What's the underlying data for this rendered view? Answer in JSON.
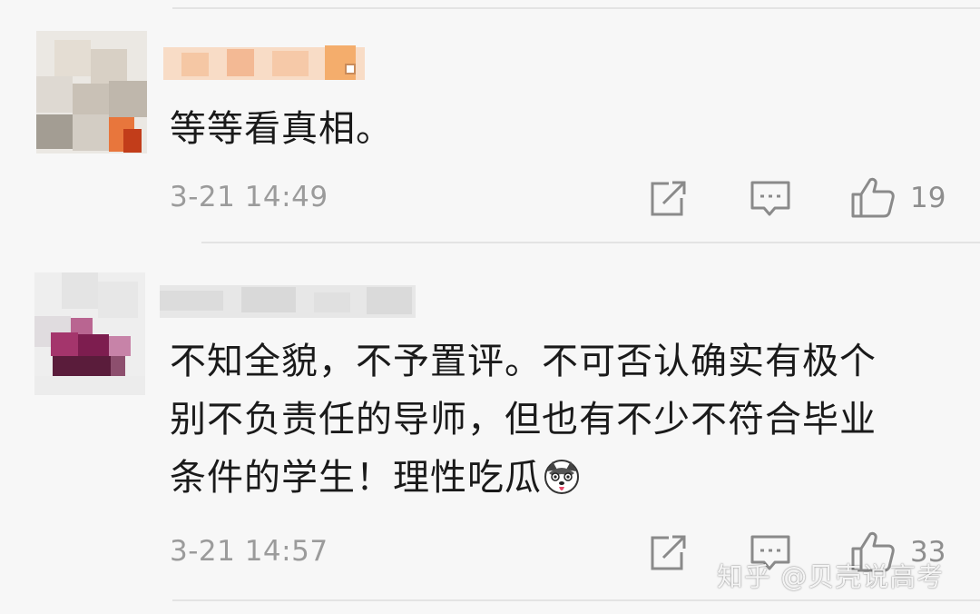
{
  "comments": [
    {
      "text": "等等看真相。",
      "timestamp": "3-21 14:49",
      "like_count": "19",
      "avatar_blurred": true,
      "username_blurred": true
    },
    {
      "text_lines": [
        "不知全貌，不予置评。不可否认确实有极个",
        "别不负责任的导师，但也有不少不符合毕业",
        "条件的学生！理性吃瓜"
      ],
      "emoji": "husky-emoji",
      "timestamp": "3-21 14:57",
      "like_count": "33",
      "avatar_blurred": true,
      "username_blurred": true
    }
  ],
  "watermark": "知乎 @贝壳说高考",
  "icons": {
    "share": "share-icon",
    "reply": "comment-icon",
    "like": "thumbs-up-icon"
  },
  "colors": {
    "background": "#f7f7f7",
    "text": "#1a1a1a",
    "meta": "#9b9b9b",
    "icon": "#8a8a8a",
    "divider": "#e3e3e3"
  }
}
